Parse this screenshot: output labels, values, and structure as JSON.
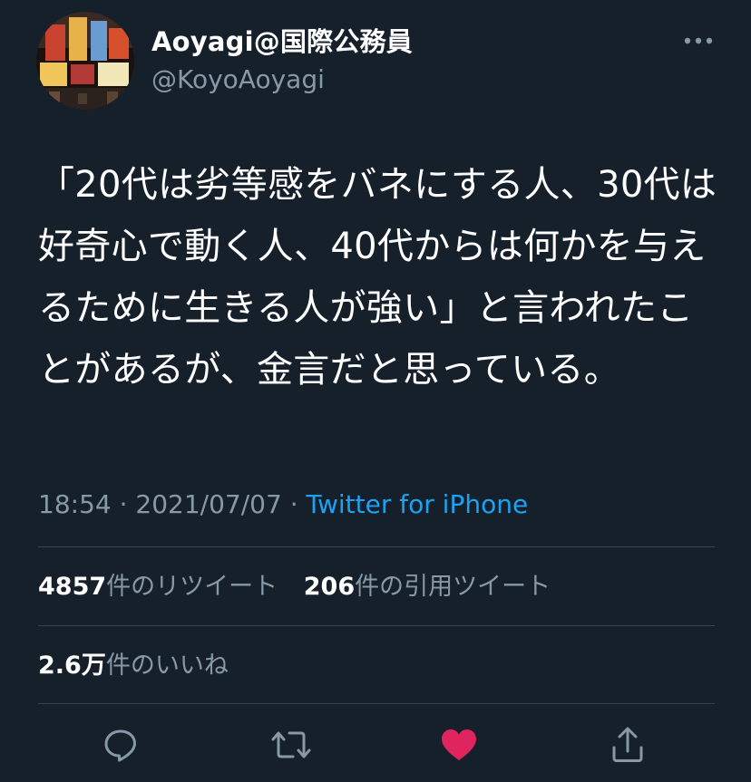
{
  "author": {
    "display_name": "Aoyagi@国際公務員",
    "handle": "@KoyoAoyagi"
  },
  "tweet": {
    "text": "「20代は劣等感をバネにする人、30代は好奇心で動く人、40代からは何かを与えるために生きる人が強い」と言われたことがあるが、金言だと思っている。",
    "time": "18:54",
    "separator1": "·",
    "date": "2021/07/07",
    "separator2": "·",
    "source": "Twitter for iPhone"
  },
  "stats": {
    "retweets_count": "4857",
    "retweets_label": "件のリツイート",
    "quotes_count": "206",
    "quotes_label": "件の引用ツイート",
    "likes_count": "2.6万",
    "likes_label": "件のいいね"
  },
  "icons": {
    "more": "more-icon",
    "reply": "reply-icon",
    "retweet": "retweet-icon",
    "like": "heart-icon",
    "share": "share-icon"
  },
  "colors": {
    "background": "#15202b",
    "secondary_text": "#8899a6",
    "link": "#1da1f2",
    "divider": "#38444d",
    "like_active": "#e0245e"
  }
}
